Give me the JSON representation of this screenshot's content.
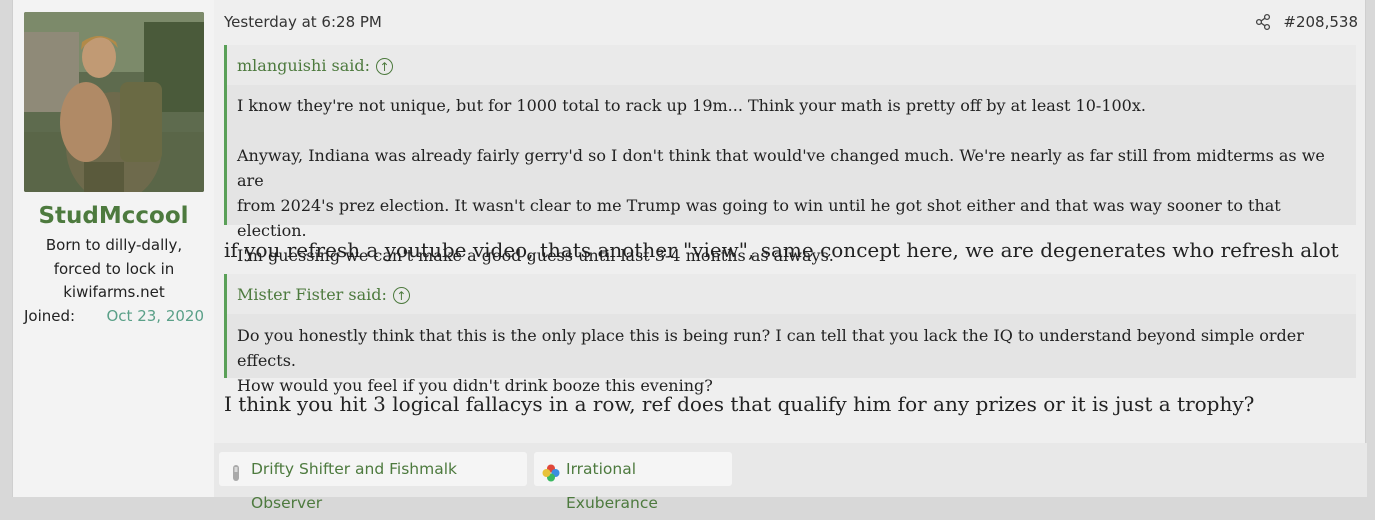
{
  "post": {
    "user": {
      "name": "StudMccool",
      "title_lines": [
        "Born to dilly-dally,",
        "forced to lock in",
        "kiwifarms.net"
      ],
      "joined_label": "Joined:",
      "joined_value": "Oct 23, 2020",
      "avatar_icon": "avatar-photo"
    },
    "date": "Yesterday at 6:28 PM",
    "number": "#208,538",
    "share_icon": "share-icon",
    "quotes": [
      {
        "author": "mlanguishi said:",
        "paragraphs": [
          "I know they're not unique, but for 1000 total to rack up 19m... Think your math is pretty off by at least 10-100x.",
          "Anyway, Indiana was already fairly gerry'd so I don't think that would've changed much. We're nearly as far still from midterms as we are\nfrom 2024's prez election. It wasn't clear to me Trump was going to win until he got shot either and that was way sooner to that election.\nI'm guessing we can't make a good guess until last 3-4 months as always."
        ]
      },
      {
        "author": "Mister Fister said:",
        "paragraphs": [
          "Do you honestly think that this is the only place this is being run? I can tell that you lack the IQ to understand beyond simple order effects.\nHow would you feel if you didn't drink booze this evening?"
        ]
      }
    ],
    "replies": [
      "if you refresh a youtube video, thats another \"view\", same concept here, we are degenerates who refresh alot",
      "I think you hit 3 logical fallacys in a row, ref does that qualify him for any prizes or it is just a trophy?"
    ],
    "reactions": [
      {
        "label": "Drifty Shifter and Fishmalk Observer",
        "icon": "drifty-shifter-icon"
      },
      {
        "label": "Irrational Exuberance",
        "icon": "puzzle-icon"
      }
    ]
  },
  "colors": {
    "accent_green": "#4d7a3e",
    "quote_border": "#5aa058",
    "joined_teal": "#5aa088"
  }
}
